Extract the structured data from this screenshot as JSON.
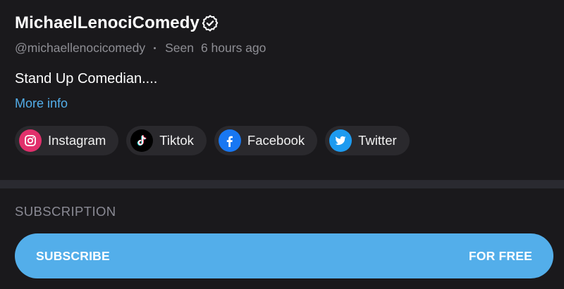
{
  "profile": {
    "name": "MichaelLenociComedy",
    "handle": "@michaellenocicomedy",
    "seen_label": "Seen",
    "seen_time": "6 hours ago",
    "bio": "Stand Up Comedian....",
    "more_info": "More info"
  },
  "socials": [
    {
      "label": "Instagram",
      "icon": "instagram-icon",
      "color": "#e1306c"
    },
    {
      "label": "Tiktok",
      "icon": "tiktok-icon",
      "color": "#000000"
    },
    {
      "label": "Facebook",
      "icon": "facebook-icon",
      "color": "#1877f2"
    },
    {
      "label": "Twitter",
      "icon": "twitter-icon",
      "color": "#1d9bf0"
    }
  ],
  "subscription": {
    "header": "SUBSCRIPTION",
    "button_left": "SUBSCRIBE",
    "button_right": "FOR FREE"
  },
  "colors": {
    "background": "#1a191c",
    "accent": "#53aeea",
    "chip": "#2a292d"
  }
}
